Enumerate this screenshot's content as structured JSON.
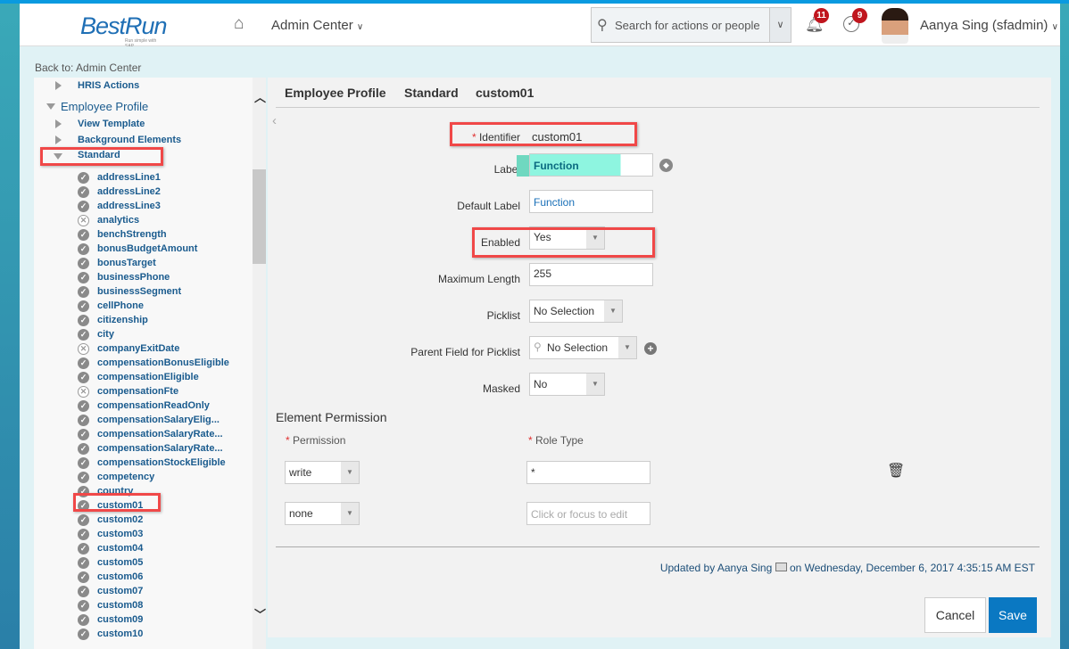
{
  "header": {
    "logo": "BestRun",
    "logo_tagline": "Run simple with SAP",
    "module": "Admin Center",
    "search_placeholder": "Search for actions or people",
    "notifications_count": "11",
    "todo_count": "9",
    "user": "Aanya Sing (sfadmin)"
  },
  "back_link": "Back to: Admin Center",
  "tree": {
    "hris": "HRIS Actions",
    "employee_profile": "Employee Profile",
    "view_template": "View Template",
    "background_elements": "Background Elements",
    "standard": "Standard",
    "fields": [
      {
        "name": "addressLine1",
        "enabled": true
      },
      {
        "name": "addressLine2",
        "enabled": true
      },
      {
        "name": "addressLine3",
        "enabled": true
      },
      {
        "name": "analytics",
        "enabled": false
      },
      {
        "name": "benchStrength",
        "enabled": true
      },
      {
        "name": "bonusBudgetAmount",
        "enabled": true
      },
      {
        "name": "bonusTarget",
        "enabled": true
      },
      {
        "name": "businessPhone",
        "enabled": true
      },
      {
        "name": "businessSegment",
        "enabled": true
      },
      {
        "name": "cellPhone",
        "enabled": true
      },
      {
        "name": "citizenship",
        "enabled": true
      },
      {
        "name": "city",
        "enabled": true
      },
      {
        "name": "companyExitDate",
        "enabled": false
      },
      {
        "name": "compensationBonusEligible",
        "enabled": true
      },
      {
        "name": "compensationEligible",
        "enabled": true
      },
      {
        "name": "compensationFte",
        "enabled": false
      },
      {
        "name": "compensationReadOnly",
        "enabled": true
      },
      {
        "name": "compensationSalaryElig...",
        "enabled": true
      },
      {
        "name": "compensationSalaryRate...",
        "enabled": true
      },
      {
        "name": "compensationSalaryRate...",
        "enabled": true
      },
      {
        "name": "compensationStockEligible",
        "enabled": true
      },
      {
        "name": "competency",
        "enabled": true
      },
      {
        "name": "country",
        "enabled": true
      },
      {
        "name": "custom01",
        "enabled": true
      },
      {
        "name": "custom02",
        "enabled": true
      },
      {
        "name": "custom03",
        "enabled": true
      },
      {
        "name": "custom04",
        "enabled": true
      },
      {
        "name": "custom05",
        "enabled": true
      },
      {
        "name": "custom06",
        "enabled": true
      },
      {
        "name": "custom07",
        "enabled": true
      },
      {
        "name": "custom08",
        "enabled": true
      },
      {
        "name": "custom09",
        "enabled": true
      },
      {
        "name": "custom10",
        "enabled": true
      }
    ]
  },
  "breadcrumb": [
    "Employee Profile",
    "Standard",
    "custom01"
  ],
  "form": {
    "identifier_label": "Identifier",
    "identifier_value": "custom01",
    "label_label": "Label",
    "label_value": "Function",
    "default_label_label": "Default Label",
    "default_label_value": "Function",
    "enabled_label": "Enabled",
    "enabled_value": "Yes",
    "max_length_label": "Maximum Length",
    "max_length_value": "255",
    "picklist_label": "Picklist",
    "picklist_value": "No Selection",
    "parent_label": "Parent Field for Picklist",
    "parent_value": "No Selection",
    "masked_label": "Masked",
    "masked_value": "No"
  },
  "permission": {
    "title": "Element Permission",
    "col_permission": "Permission",
    "col_role": "Role Type",
    "rows": [
      {
        "permission": "write",
        "role": "*"
      },
      {
        "permission": "none",
        "role": ""
      }
    ],
    "role_placeholder": "Click or focus to edit"
  },
  "updated": "Updated by Aanya Sing",
  "updated_on": "on Wednesday, December 6, 2017 4:35:15 AM EST",
  "buttons": {
    "cancel": "Cancel",
    "save": "Save"
  },
  "colors": {
    "accent": "#0a78c2",
    "highlight": "#f04848",
    "label_fill": "#8ef5e0"
  }
}
